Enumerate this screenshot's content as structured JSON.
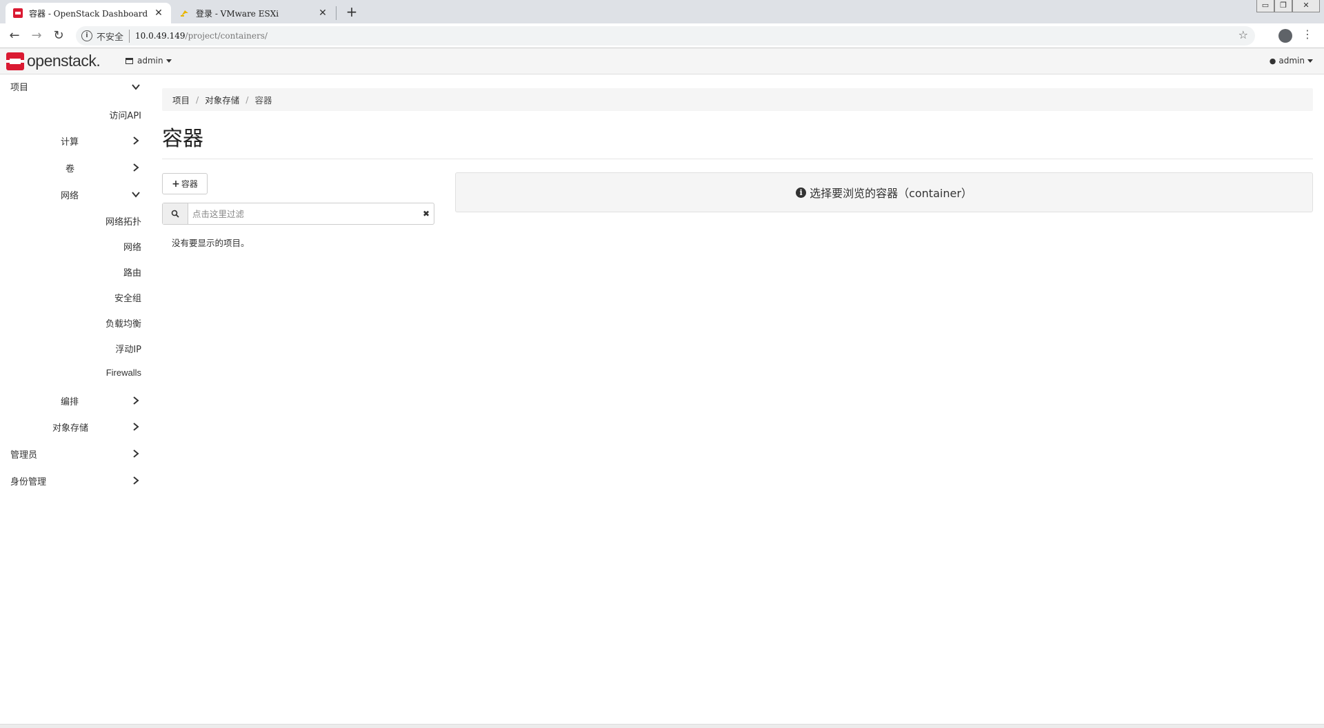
{
  "browser": {
    "tabs": [
      {
        "title": "容器 - OpenStack Dashboard",
        "active": true
      },
      {
        "title": "登录 - VMware ESXi",
        "active": false
      }
    ],
    "new_tab": "+",
    "close_glyph": "✕",
    "address": {
      "security_label": "不安全",
      "host": "10.0.49.149",
      "path": "/project/containers/"
    }
  },
  "header": {
    "logo_text": "openstack.",
    "project_label": "admin",
    "user_label": "admin"
  },
  "sidebar": {
    "items": [
      {
        "label": "项目",
        "level": 0,
        "expanded": true
      },
      {
        "label": "访问API",
        "level": 2
      },
      {
        "label": "计算",
        "level": 1,
        "expanded": false
      },
      {
        "label": "卷",
        "level": 1,
        "expanded": false
      },
      {
        "label": "网络",
        "level": 1,
        "expanded": true
      },
      {
        "label": "网络拓扑",
        "level": 2
      },
      {
        "label": "网络",
        "level": 2
      },
      {
        "label": "路由",
        "level": 2
      },
      {
        "label": "安全组",
        "level": 2
      },
      {
        "label": "负载均衡",
        "level": 2
      },
      {
        "label": "浮动IP",
        "level": 2
      },
      {
        "label": "Firewalls",
        "level": 2
      },
      {
        "label": "编排",
        "level": 1,
        "expanded": false
      },
      {
        "label": "对象存储",
        "level": 1,
        "expanded": false
      },
      {
        "label": "管理员",
        "level": 0,
        "expanded": false
      },
      {
        "label": "身份管理",
        "level": 0,
        "expanded": false
      }
    ]
  },
  "breadcrumb": [
    "项目",
    "对象存储",
    "容器"
  ],
  "breadcrumb_sep": "/",
  "page": {
    "title": "容器",
    "create_button": "容器",
    "filter_placeholder": "点击这里过滤",
    "empty_message": "没有要显示的项目。",
    "info_message": "选择要浏览的容器（container）"
  },
  "colors": {
    "brand_red": "#da1a32",
    "header_bg": "#f5f5f5"
  }
}
